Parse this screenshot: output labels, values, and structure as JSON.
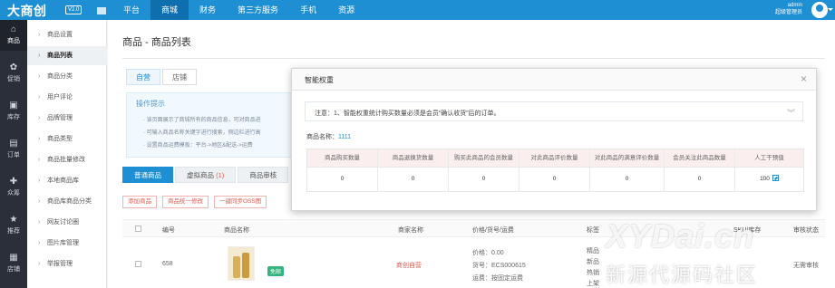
{
  "header": {
    "logo": "大商创",
    "version": "V2.0",
    "nav": [
      "平台",
      "商城",
      "财务",
      "第三方服务",
      "手机",
      "资源"
    ],
    "active_nav_index": 1,
    "admin_name": "admin",
    "admin_role": "超级管理员"
  },
  "iconbar": [
    {
      "label": "商品",
      "icon": "shop-icon",
      "active": true
    },
    {
      "label": "促销",
      "icon": "promo-icon",
      "active": false
    },
    {
      "label": "库存",
      "icon": "stock-icon",
      "active": false
    },
    {
      "label": "订单",
      "icon": "order-icon",
      "active": false
    },
    {
      "label": "众筹",
      "icon": "crowd-icon",
      "active": false
    },
    {
      "label": "推荐",
      "icon": "star-icon",
      "active": false
    },
    {
      "label": "店铺",
      "icon": "store-icon",
      "active": false
    }
  ],
  "sidebar": {
    "items": [
      "商品设置",
      "商品列表",
      "商品分类",
      "用户评论",
      "品牌管理",
      "商品类型",
      "商品批量修改",
      "本地商品库",
      "商品库商品分类",
      "网友讨论圈",
      "图片库管理",
      "举报管理"
    ],
    "active_index": 1
  },
  "page": {
    "title": "商品 - 商品列表",
    "tabs": [
      "自营",
      "店铺"
    ],
    "tips_title": "操作提示",
    "tips": [
      "· 该页面展示了商城所有的商品信息，可对商品进",
      "· 可输入商品名称关键字进行搜索，侧边栏进行高",
      "· 设置商品运费模板：平台->地区&配送->运费"
    ],
    "subtabs": [
      "普通商品",
      "虚拟商品",
      "商品审核"
    ],
    "subtab_counts": [
      "",
      "(1)",
      ""
    ],
    "buttons": [
      "添加商品",
      "商品统一修改",
      "一键同步OSS图"
    ],
    "columns": [
      "编号",
      "商品名称",
      "商家名称",
      "价格/货号/运费",
      "标签",
      "SKU/库存",
      "审核状态"
    ],
    "row": {
      "id": "658",
      "badge": "免邮",
      "shop": "商创自营",
      "price": "价格：0.00",
      "sn": "货号：ECS000615",
      "freight": "运费：按固定运费",
      "tags": [
        "精品",
        "新品",
        "热销",
        "上架"
      ],
      "status": "无需审核"
    }
  },
  "modal": {
    "title": "智能权重",
    "notice": "注意：1、智能权重统计购买数量必须是会员“确认收货”后的订单。",
    "product_label": "商品名称：",
    "product_value": "1111",
    "columns": [
      "商品购买数量",
      "商品退换货数量",
      "购买此商品的会员数量",
      "对此商品评价数量",
      "对此商品的满意评价数量",
      "会员关注此商品数量",
      "人工干预值"
    ],
    "values": [
      "0",
      "0",
      "0",
      "0",
      "0",
      "0",
      "100"
    ]
  },
  "watermark": {
    "line1": "XYDai.cn",
    "line2": "新源代源码社区"
  },
  "colors": {
    "primary": "#1d8fd2",
    "sidebar_dark": "#2b2f3a",
    "danger": "#e05a4f",
    "modal_header_row": "#fbeeee"
  }
}
